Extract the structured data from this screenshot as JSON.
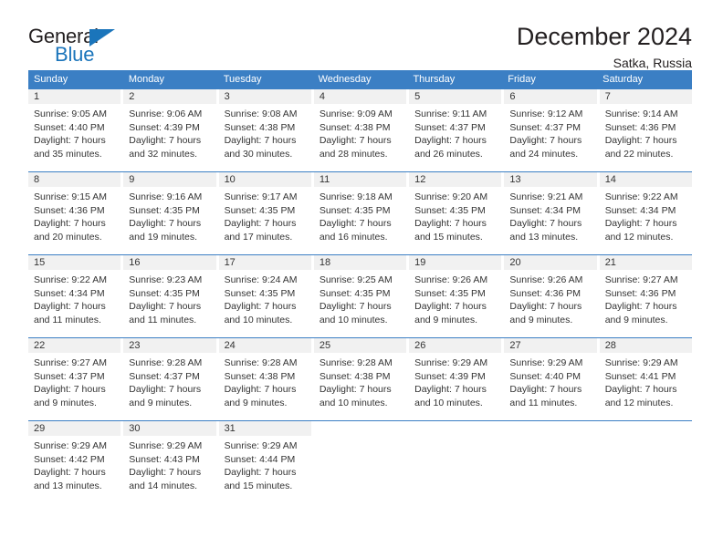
{
  "logo": {
    "word_one": "General",
    "word_two": "Blue",
    "triangle_icon": "blue-triangle-icon",
    "brand_color": "#1b75bb"
  },
  "header": {
    "title": "December 2024",
    "location": "Satka, Russia",
    "header_bg_color": "#3b7fc4",
    "daynum_bg_color": "#f1f1f1"
  },
  "calendar": {
    "weekday_headers": [
      "Sunday",
      "Monday",
      "Tuesday",
      "Wednesday",
      "Thursday",
      "Friday",
      "Saturday"
    ],
    "weeks": [
      [
        {
          "day": "1",
          "sunrise": "Sunrise: 9:05 AM",
          "sunset": "Sunset: 4:40 PM",
          "daylight_line1": "Daylight: 7 hours",
          "daylight_line2": "and 35 minutes."
        },
        {
          "day": "2",
          "sunrise": "Sunrise: 9:06 AM",
          "sunset": "Sunset: 4:39 PM",
          "daylight_line1": "Daylight: 7 hours",
          "daylight_line2": "and 32 minutes."
        },
        {
          "day": "3",
          "sunrise": "Sunrise: 9:08 AM",
          "sunset": "Sunset: 4:38 PM",
          "daylight_line1": "Daylight: 7 hours",
          "daylight_line2": "and 30 minutes."
        },
        {
          "day": "4",
          "sunrise": "Sunrise: 9:09 AM",
          "sunset": "Sunset: 4:38 PM",
          "daylight_line1": "Daylight: 7 hours",
          "daylight_line2": "and 28 minutes."
        },
        {
          "day": "5",
          "sunrise": "Sunrise: 9:11 AM",
          "sunset": "Sunset: 4:37 PM",
          "daylight_line1": "Daylight: 7 hours",
          "daylight_line2": "and 26 minutes."
        },
        {
          "day": "6",
          "sunrise": "Sunrise: 9:12 AM",
          "sunset": "Sunset: 4:37 PM",
          "daylight_line1": "Daylight: 7 hours",
          "daylight_line2": "and 24 minutes."
        },
        {
          "day": "7",
          "sunrise": "Sunrise: 9:14 AM",
          "sunset": "Sunset: 4:36 PM",
          "daylight_line1": "Daylight: 7 hours",
          "daylight_line2": "and 22 minutes."
        }
      ],
      [
        {
          "day": "8",
          "sunrise": "Sunrise: 9:15 AM",
          "sunset": "Sunset: 4:36 PM",
          "daylight_line1": "Daylight: 7 hours",
          "daylight_line2": "and 20 minutes."
        },
        {
          "day": "9",
          "sunrise": "Sunrise: 9:16 AM",
          "sunset": "Sunset: 4:35 PM",
          "daylight_line1": "Daylight: 7 hours",
          "daylight_line2": "and 19 minutes."
        },
        {
          "day": "10",
          "sunrise": "Sunrise: 9:17 AM",
          "sunset": "Sunset: 4:35 PM",
          "daylight_line1": "Daylight: 7 hours",
          "daylight_line2": "and 17 minutes."
        },
        {
          "day": "11",
          "sunrise": "Sunrise: 9:18 AM",
          "sunset": "Sunset: 4:35 PM",
          "daylight_line1": "Daylight: 7 hours",
          "daylight_line2": "and 16 minutes."
        },
        {
          "day": "12",
          "sunrise": "Sunrise: 9:20 AM",
          "sunset": "Sunset: 4:35 PM",
          "daylight_line1": "Daylight: 7 hours",
          "daylight_line2": "and 15 minutes."
        },
        {
          "day": "13",
          "sunrise": "Sunrise: 9:21 AM",
          "sunset": "Sunset: 4:34 PM",
          "daylight_line1": "Daylight: 7 hours",
          "daylight_line2": "and 13 minutes."
        },
        {
          "day": "14",
          "sunrise": "Sunrise: 9:22 AM",
          "sunset": "Sunset: 4:34 PM",
          "daylight_line1": "Daylight: 7 hours",
          "daylight_line2": "and 12 minutes."
        }
      ],
      [
        {
          "day": "15",
          "sunrise": "Sunrise: 9:22 AM",
          "sunset": "Sunset: 4:34 PM",
          "daylight_line1": "Daylight: 7 hours",
          "daylight_line2": "and 11 minutes."
        },
        {
          "day": "16",
          "sunrise": "Sunrise: 9:23 AM",
          "sunset": "Sunset: 4:35 PM",
          "daylight_line1": "Daylight: 7 hours",
          "daylight_line2": "and 11 minutes."
        },
        {
          "day": "17",
          "sunrise": "Sunrise: 9:24 AM",
          "sunset": "Sunset: 4:35 PM",
          "daylight_line1": "Daylight: 7 hours",
          "daylight_line2": "and 10 minutes."
        },
        {
          "day": "18",
          "sunrise": "Sunrise: 9:25 AM",
          "sunset": "Sunset: 4:35 PM",
          "daylight_line1": "Daylight: 7 hours",
          "daylight_line2": "and 10 minutes."
        },
        {
          "day": "19",
          "sunrise": "Sunrise: 9:26 AM",
          "sunset": "Sunset: 4:35 PM",
          "daylight_line1": "Daylight: 7 hours",
          "daylight_line2": "and 9 minutes."
        },
        {
          "day": "20",
          "sunrise": "Sunrise: 9:26 AM",
          "sunset": "Sunset: 4:36 PM",
          "daylight_line1": "Daylight: 7 hours",
          "daylight_line2": "and 9 minutes."
        },
        {
          "day": "21",
          "sunrise": "Sunrise: 9:27 AM",
          "sunset": "Sunset: 4:36 PM",
          "daylight_line1": "Daylight: 7 hours",
          "daylight_line2": "and 9 minutes."
        }
      ],
      [
        {
          "day": "22",
          "sunrise": "Sunrise: 9:27 AM",
          "sunset": "Sunset: 4:37 PM",
          "daylight_line1": "Daylight: 7 hours",
          "daylight_line2": "and 9 minutes."
        },
        {
          "day": "23",
          "sunrise": "Sunrise: 9:28 AM",
          "sunset": "Sunset: 4:37 PM",
          "daylight_line1": "Daylight: 7 hours",
          "daylight_line2": "and 9 minutes."
        },
        {
          "day": "24",
          "sunrise": "Sunrise: 9:28 AM",
          "sunset": "Sunset: 4:38 PM",
          "daylight_line1": "Daylight: 7 hours",
          "daylight_line2": "and 9 minutes."
        },
        {
          "day": "25",
          "sunrise": "Sunrise: 9:28 AM",
          "sunset": "Sunset: 4:38 PM",
          "daylight_line1": "Daylight: 7 hours",
          "daylight_line2": "and 10 minutes."
        },
        {
          "day": "26",
          "sunrise": "Sunrise: 9:29 AM",
          "sunset": "Sunset: 4:39 PM",
          "daylight_line1": "Daylight: 7 hours",
          "daylight_line2": "and 10 minutes."
        },
        {
          "day": "27",
          "sunrise": "Sunrise: 9:29 AM",
          "sunset": "Sunset: 4:40 PM",
          "daylight_line1": "Daylight: 7 hours",
          "daylight_line2": "and 11 minutes."
        },
        {
          "day": "28",
          "sunrise": "Sunrise: 9:29 AM",
          "sunset": "Sunset: 4:41 PM",
          "daylight_line1": "Daylight: 7 hours",
          "daylight_line2": "and 12 minutes."
        }
      ],
      [
        {
          "day": "29",
          "sunrise": "Sunrise: 9:29 AM",
          "sunset": "Sunset: 4:42 PM",
          "daylight_line1": "Daylight: 7 hours",
          "daylight_line2": "and 13 minutes."
        },
        {
          "day": "30",
          "sunrise": "Sunrise: 9:29 AM",
          "sunset": "Sunset: 4:43 PM",
          "daylight_line1": "Daylight: 7 hours",
          "daylight_line2": "and 14 minutes."
        },
        {
          "day": "31",
          "sunrise": "Sunrise: 9:29 AM",
          "sunset": "Sunset: 4:44 PM",
          "daylight_line1": "Daylight: 7 hours",
          "daylight_line2": "and 15 minutes."
        },
        {
          "day": "",
          "sunrise": "",
          "sunset": "",
          "daylight_line1": "",
          "daylight_line2": ""
        },
        {
          "day": "",
          "sunrise": "",
          "sunset": "",
          "daylight_line1": "",
          "daylight_line2": ""
        },
        {
          "day": "",
          "sunrise": "",
          "sunset": "",
          "daylight_line1": "",
          "daylight_line2": ""
        },
        {
          "day": "",
          "sunrise": "",
          "sunset": "",
          "daylight_line1": "",
          "daylight_line2": ""
        }
      ]
    ]
  }
}
